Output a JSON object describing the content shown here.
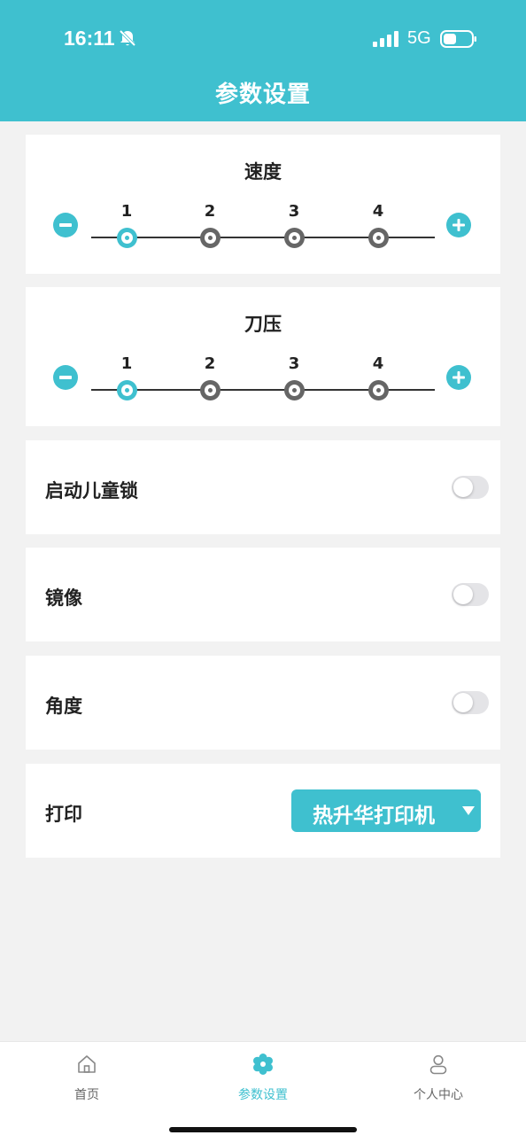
{
  "status_bar": {
    "time": "16:11",
    "network": "5G",
    "icons": [
      "bell-muted-icon",
      "signal-icon",
      "battery-icon"
    ]
  },
  "header": {
    "title": "参数设置"
  },
  "colors": {
    "accent": "#3fc0cf",
    "background": "#f2f2f2",
    "inactive_node": "#666666"
  },
  "speed": {
    "title": "速度",
    "levels": [
      "1",
      "2",
      "3",
      "4"
    ],
    "selected": "1"
  },
  "blade_pressure": {
    "title": "刀压",
    "levels": [
      "1",
      "2",
      "3",
      "4"
    ],
    "selected": "1"
  },
  "settings": [
    {
      "label": "启动儿童锁",
      "enabled": false
    },
    {
      "label": "镜像",
      "enabled": false
    },
    {
      "label": "角度",
      "enabled": false
    }
  ],
  "print": {
    "label": "打印",
    "selected_printer": "热升华打印机"
  },
  "tabbar": {
    "tabs": [
      {
        "label": "首页",
        "icon": "home-icon",
        "active": false
      },
      {
        "label": "参数设置",
        "icon": "gear-icon",
        "active": true
      },
      {
        "label": "个人中心",
        "icon": "user-icon",
        "active": false
      }
    ]
  }
}
